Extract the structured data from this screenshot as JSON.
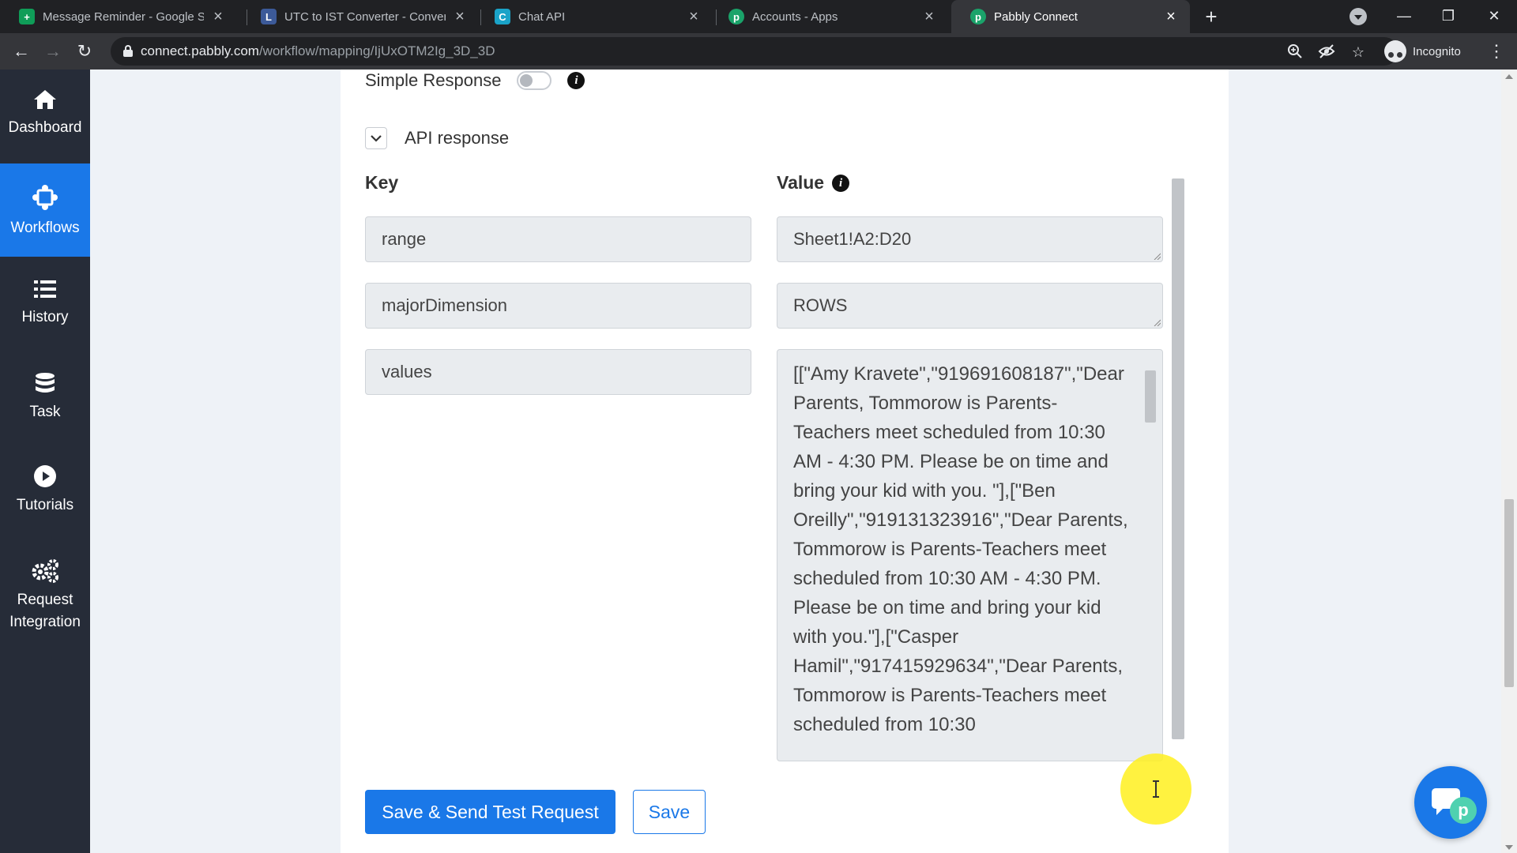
{
  "browser": {
    "tabs": [
      {
        "title": "Message Reminder - Google She",
        "favicon_color": "#0f9d58",
        "favicon_glyph": "+"
      },
      {
        "title": "UTC to IST Converter - Convert U",
        "favicon_color": "#3c5a99",
        "favicon_glyph": "L"
      },
      {
        "title": "Chat API",
        "favicon_color": "#1aa3c8",
        "favicon_glyph": "C"
      },
      {
        "title": "Accounts - Apps",
        "favicon_color": "#1aa36a",
        "favicon_glyph": "p"
      },
      {
        "title": "Pabbly Connect",
        "favicon_color": "#1aa36a",
        "favicon_glyph": "p"
      }
    ],
    "active_tab": 4,
    "url_host": "connect.pabbly.com",
    "url_path": "/workflow/mapping/IjUxOTM2Ig_3D_3D",
    "incognito_label": "Incognito"
  },
  "sidebar": {
    "items": [
      {
        "label": "Dashboard",
        "icon": "home-icon"
      },
      {
        "label": "Workflows",
        "icon": "workflow-icon"
      },
      {
        "label": "History",
        "icon": "list-icon"
      },
      {
        "label": "Task",
        "icon": "database-icon"
      },
      {
        "label": "Tutorials",
        "icon": "play-icon"
      },
      {
        "label": "Request Integration",
        "icon": "gears-icon"
      }
    ],
    "active_index": 1
  },
  "form": {
    "simple_response_label": "Simple Response",
    "simple_response_on": false,
    "section_title": "API response",
    "key_header": "Key",
    "value_header": "Value",
    "rows": [
      {
        "key": "range",
        "value": "Sheet1!A2:D20"
      },
      {
        "key": "majorDimension",
        "value": "ROWS"
      },
      {
        "key": "values",
        "value": "[[\"Amy Kravete\",\"919691608187\",\"Dear Parents, Tommorow is Parents-Teachers meet scheduled from 10:30 AM - 4:30 PM. Please be on time and bring your kid with you.  \"],[\"Ben Oreilly\",\"919131323916\",\"Dear Parents, Tommorow is Parents-Teachers meet scheduled from 10:30 AM - 4:30 PM. Please be on time and bring your kid with you.\"],[\"Casper Hamil\",\"917415929634\",\"Dear Parents, Tommorow is Parents-Teachers meet scheduled from 10:30"
      }
    ],
    "save_test_label": "Save & Send Test Request",
    "save_label": "Save"
  },
  "colors": {
    "primary": "#1a78e8",
    "sidebar_bg": "#262c38",
    "cursor_highlight": "#fff01e"
  }
}
